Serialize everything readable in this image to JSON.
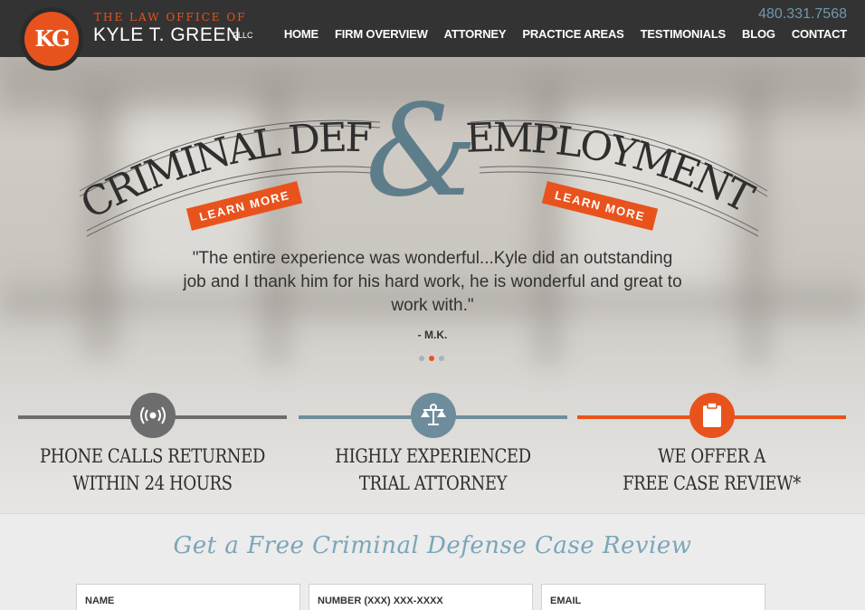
{
  "header": {
    "logo_text": "KG",
    "brand_top": "THE LAW OFFICE OF",
    "brand_name": "KYLE T. GREEN",
    "brand_suffix": "PLLC",
    "phone": "480.331.7568",
    "nav": [
      "HOME",
      "FIRM OVERVIEW",
      "ATTORNEY",
      "PRACTICE AREAS",
      "TESTIMONIALS",
      "BLOG",
      "CONTACT"
    ]
  },
  "hero": {
    "left_title": "CRIMINAL DEFENSE",
    "ampersand": "&",
    "right_title": "EMPLOYMENT LAW",
    "learn_more_left": "LEARN MORE",
    "learn_more_right": "LEARN MORE",
    "quote": "\"The entire experience was wonderful...Kyle did an outstanding job and I thank him for his hard work, he is wonderful and great to work with.\"",
    "quote_author": "- M.K.",
    "slide_count": 3,
    "active_slide": 2
  },
  "features": [
    {
      "icon": "phone-signal-icon",
      "line1": "PHONE CALLS RETURNED",
      "line2": "WITHIN 24 HOURS",
      "color": "#6d6d6d"
    },
    {
      "icon": "scales-icon",
      "line1": "HIGHLY EXPERIENCED",
      "line2": "TRIAL ATTORNEY",
      "color": "#6d8d9c"
    },
    {
      "icon": "clipboard-icon",
      "line1": "WE OFFER A",
      "line2": "FREE CASE REVIEW*",
      "color": "#e8531d"
    }
  ],
  "form": {
    "title": "Get a Free Criminal Defense Case Review",
    "fields": [
      "NAME",
      "NUMBER (XXX) XXX-XXXX",
      "EMAIL"
    ]
  },
  "colors": {
    "accent": "#e8531d",
    "blue": "#6d8d9c",
    "header_bg": "#333333"
  }
}
